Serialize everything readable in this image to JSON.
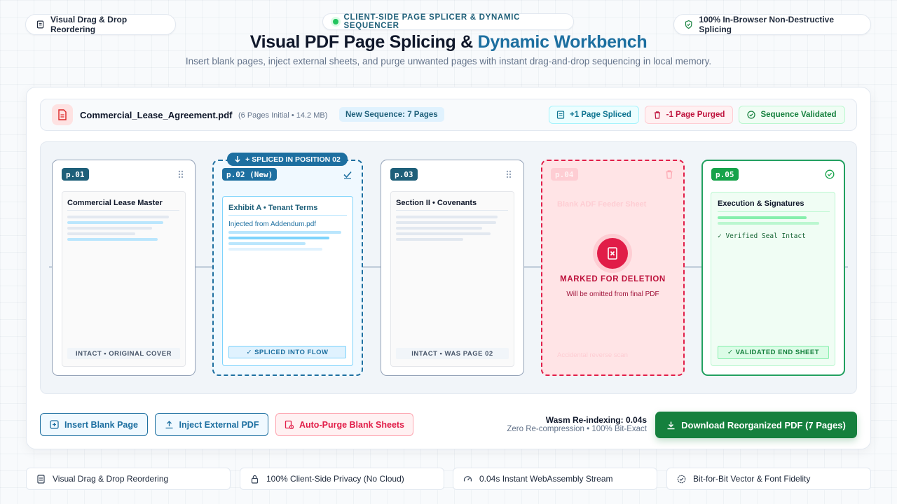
{
  "header": {
    "left_pill": "Visual Drag & Drop Reordering",
    "center_pill": "CLIENT-SIDE PAGE SPLICER & DYNAMIC SEQUENCER",
    "right_pill": "100% In-Browser Non-Destructive Splicing",
    "title_main": "Visual PDF Page Splicing &",
    "title_accent": "Dynamic Workbench",
    "subtitle": "Insert blank pages, inject external sheets, and purge unwanted pages with instant drag-and-drop sequencing in local memory."
  },
  "file": {
    "name": "Commercial_Lease_Agreement.pdf",
    "meta": "(6 Pages Initial • 14.2 MB)",
    "sequence": "New Sequence: 7 Pages",
    "status_spliced": "+1 Page Spliced",
    "status_purged": "-1 Page Purged",
    "status_validated": "Sequence Validated"
  },
  "pages": {
    "p1": {
      "tag": "p.01",
      "title": "Commercial Lease Master",
      "footer": "INTACT • ORIGINAL COVER"
    },
    "p2": {
      "badge": "+ SPLICED IN POSITION 02",
      "tag": "p.02 (New)",
      "title": "Exhibit A • Tenant Terms",
      "note": "Injected from Addendum.pdf",
      "footer": "✓ SPLICED INTO FLOW"
    },
    "p3": {
      "tag": "p.03",
      "title": "Section II • Covenants",
      "footer": "INTACT • WAS PAGE 02"
    },
    "p4": {
      "tag": "p.04",
      "title": "Blank ADF Feeder Sheet",
      "marked": "MARKED FOR DELETION",
      "marked_sub": "Will be omitted from final PDF",
      "footer": "Accidental reverse scan"
    },
    "p5": {
      "tag": "p.05",
      "title": "Execution & Signatures",
      "note": "✓ Verified Seal Intact",
      "footer": "✓ VALIDATED END SHEET"
    }
  },
  "actions": {
    "insert_blank": "Insert Blank Page",
    "inject_external": "Inject External PDF",
    "auto_purge": "Auto-Purge Blank Sheets",
    "perf_main": "Wasm Re-indexing: 0.04s",
    "perf_sub": "Zero Re-compression • 100% Bit-Exact",
    "download": "Download Reorganized PDF (7 Pages)"
  },
  "features": [
    "Visual Drag & Drop Reordering",
    "100% Client-Side Privacy (No Cloud)",
    "0.04s Instant WebAssembly Stream",
    "Bit-for-Bit Vector & Font Fidelity"
  ],
  "colors": {
    "accent": "#1d6fa0",
    "success": "#15803d",
    "danger": "#e11d48"
  }
}
